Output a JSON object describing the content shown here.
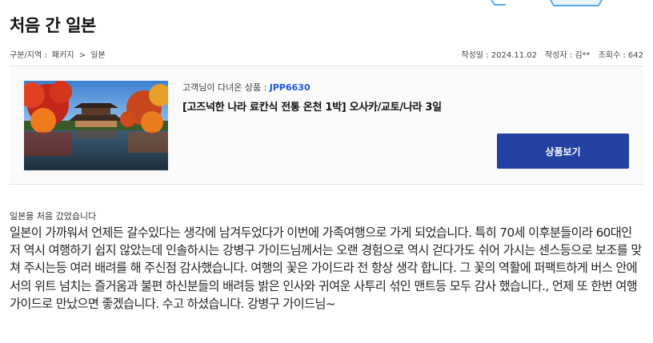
{
  "page_title": "처음 간 일본",
  "breadcrumb": {
    "label": "구분/지역 :",
    "category": "패키지",
    "separator": ">",
    "region": "일본"
  },
  "meta": {
    "date_label": "작성일 :",
    "date_value": "2024.11.02",
    "author_label": "작성자 :",
    "author_value": "김**",
    "views_label": "조회수 :",
    "views_value": "642"
  },
  "product": {
    "visited_label": "고객님이 다녀온 상품 :",
    "code": "JPP6630",
    "name": "[고즈넉한 나라 료칸식 전통 온천 1박] 오사카/교토/나라 3일",
    "button_label": "상품보기",
    "thumbnail_icon": "temple-autumn-photo"
  },
  "review": {
    "title": "일본을 처음 갔었습니다",
    "body": "일본이 가까워서 언제든 갈수있다는 생각에 남겨두었다가 이번에 가족여행으로 가게 되었습니다. 특히 70세 이후분들이라 60대인 저 역시 여행하기 쉽지 않았는데 인솔하시는 강병구 가이드님께서는 오랜 경험으로 역시 걷다가도 쉬어 가시는 센스등으로 보조를 맞쳐 주시는등 여러 배려를 해 주신점 감사했습니다.   여행의 꽃은 가이드라 전 항상 생각 합니다. 그 꽃의 역활에 퍼팩트하게 버스 안에서의 위트 넘치는 즐거움과 불편 하신분들의 배려등 밝은 인사와 귀여운 사투리 섞인 맨트등 모두 감사  했습니다., 언제 또 한번 여행 가이드로 만났으면 좋겠습니다. 수고 하셨습니다. 강병구 가이드님~"
  },
  "colors": {
    "accent": "#2340a3",
    "code": "#1a56d6"
  }
}
